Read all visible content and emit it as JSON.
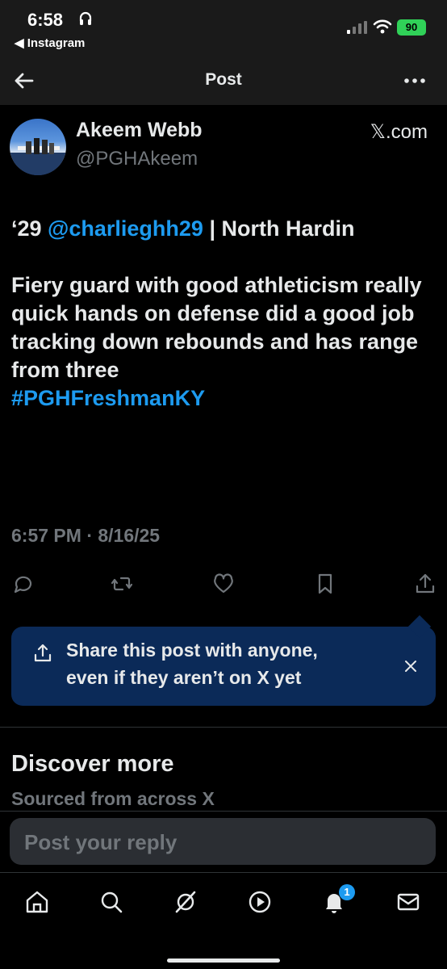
{
  "status_bar": {
    "time": "6:58",
    "back_app": "◀ Instagram",
    "battery": "90"
  },
  "header": {
    "title": "Post"
  },
  "post": {
    "author_name": "Akeem Webb",
    "author_handle": "@PGHAkeem",
    "source": "𝕏.com",
    "text_prefix": "‘29 ",
    "mention": "@charlieghh29",
    "text_after_mention": " | North Hardin",
    "body": "Fiery guard with good athleticism really quick hands on defense did a good job tracking down rebounds and has range from three",
    "hashtag": "#PGHFreshmanKY",
    "timestamp": "6:57 PM · 8/16/25"
  },
  "share_prompt": {
    "line1": "Share this post with anyone,",
    "line2": "even if they aren’t on X yet"
  },
  "discover": {
    "title": "Discover more",
    "subtitle": "Sourced from across X"
  },
  "reply": {
    "placeholder": "Post your reply"
  },
  "tabbar": {
    "notification_count": "1"
  },
  "colors": {
    "link": "#1d9bf0",
    "share_bg": "#0b2a58",
    "muted": "#71767b"
  }
}
